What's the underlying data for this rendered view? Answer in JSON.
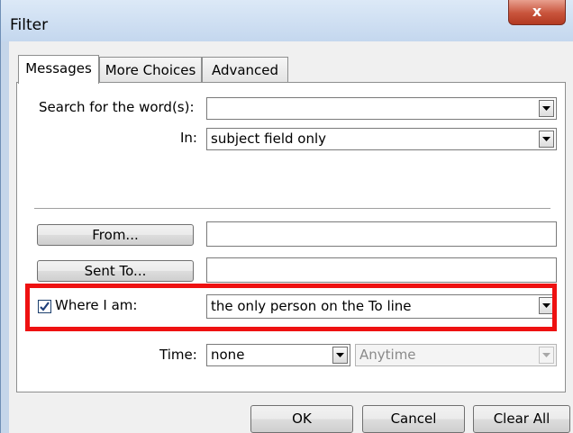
{
  "window": {
    "title": "Filter",
    "close_symbol": "x"
  },
  "tabs": [
    {
      "label": "Messages",
      "active": true
    },
    {
      "label": "More Choices",
      "active": false
    },
    {
      "label": "Advanced",
      "active": false
    }
  ],
  "form": {
    "search_label": "Search for the word(s):",
    "search_value": "",
    "in_label": "In:",
    "in_value": "subject field only",
    "from_button": "From...",
    "from_value": "",
    "sent_to_button": "Sent To...",
    "sent_to_value": "",
    "where_label": "Where I am:",
    "where_checked": true,
    "where_value": "the only person on the To line",
    "time_label": "Time:",
    "time_value": "none",
    "time_range_value": "Anytime"
  },
  "buttons": {
    "ok": "OK",
    "cancel": "Cancel",
    "clear_all": "Clear All"
  },
  "colors": {
    "highlight": "#ee1111",
    "titlebar": "#c4d7ee",
    "close": "#c8533b"
  }
}
